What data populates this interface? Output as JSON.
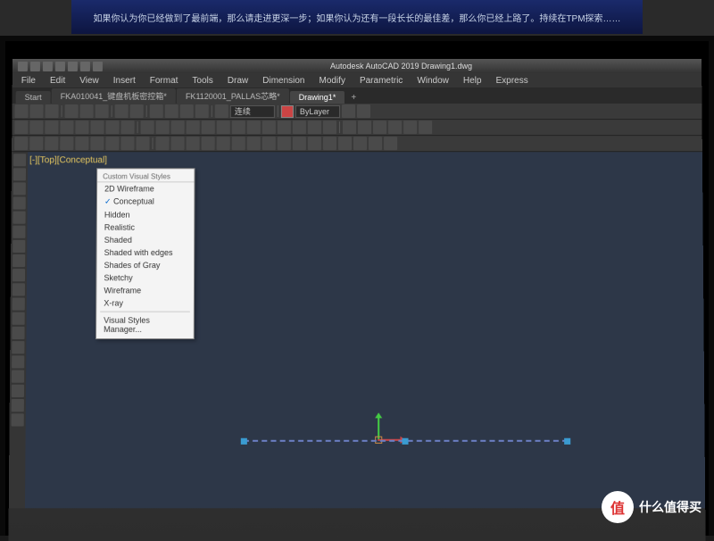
{
  "poster_text": "如果你认为你已经做到了最前端，那么请走进更深一步；如果你认为还有一段长长的最佳差，那么你已经上路了。持续在TPM探索……",
  "title": "Autodesk AutoCAD 2019   Drawing1.dwg",
  "menu": [
    "File",
    "Edit",
    "View",
    "Insert",
    "Format",
    "Tools",
    "Draw",
    "Dimension",
    "Modify",
    "Parametric",
    "Window",
    "Help",
    "Express"
  ],
  "tabs": [
    {
      "label": "Start",
      "active": false
    },
    {
      "label": "FKA010041_键盘机板密控箱*",
      "active": false
    },
    {
      "label": "FK1120001_PALLAS芯略*",
      "active": false
    },
    {
      "label": "Drawing1*",
      "active": true
    }
  ],
  "tab_add": "+",
  "layer_dropdown": "ByLayer",
  "linetype_dropdown": "连续",
  "viewport_label": "[-][Top][Conceptual]",
  "visual_styles": {
    "header": "Custom Visual Styles",
    "items": [
      {
        "label": "2D Wireframe",
        "checked": false
      },
      {
        "label": "Conceptual",
        "checked": true
      },
      {
        "label": "Hidden",
        "checked": false
      },
      {
        "label": "Realistic",
        "checked": false
      },
      {
        "label": "Shaded",
        "checked": false
      },
      {
        "label": "Shaded with edges",
        "checked": false
      },
      {
        "label": "Shades of Gray",
        "checked": false
      },
      {
        "label": "Sketchy",
        "checked": false
      },
      {
        "label": "Wireframe",
        "checked": false
      },
      {
        "label": "X-ray",
        "checked": false
      }
    ],
    "footer": "Visual Styles Manager..."
  },
  "watermark": {
    "badge": "值",
    "text": "什么值得买"
  }
}
